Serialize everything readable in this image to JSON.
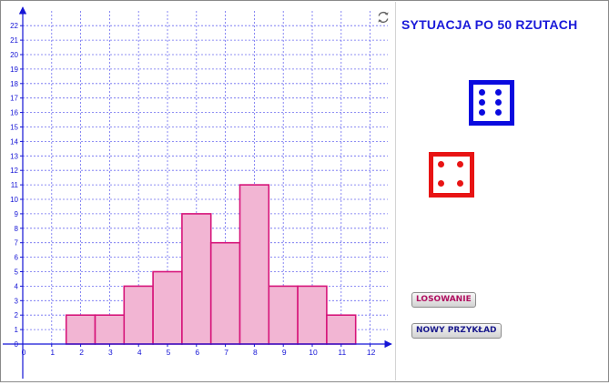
{
  "title": "SYTUACJA PO 50 RZUTACH",
  "dice": {
    "blue": {
      "value": 6,
      "color": "#0a0adf"
    },
    "red": {
      "value": 4,
      "color": "#e81414"
    }
  },
  "buttons": {
    "draw_label": "LOSOWANIE",
    "new_example_label": "NOWY PRZYKŁAD"
  },
  "icons": {
    "refresh": "refresh-icon"
  },
  "colors": {
    "axis": "#1515d6",
    "grid": "#6c6cf0",
    "bar_fill": "#f2b5d3",
    "bar_stroke": "#d6157a"
  },
  "chart_data": {
    "type": "bar",
    "title": "",
    "xlabel": "",
    "ylabel": "",
    "categories": [
      "2",
      "3",
      "4",
      "5",
      "6",
      "7",
      "8",
      "9",
      "10",
      "11"
    ],
    "values": [
      2,
      2,
      4,
      5,
      9,
      7,
      11,
      4,
      4,
      2
    ],
    "x_ticks": [
      "0",
      "1",
      "2",
      "3",
      "4",
      "5",
      "6",
      "7",
      "8",
      "9",
      "10",
      "11",
      "12"
    ],
    "y_ticks": [
      "0",
      "1",
      "2",
      "3",
      "4",
      "5",
      "6",
      "7",
      "8",
      "9",
      "10",
      "11",
      "12",
      "13",
      "14",
      "15",
      "16",
      "17",
      "18",
      "19",
      "20",
      "21",
      "22"
    ],
    "xlim": [
      0,
      12
    ],
    "ylim": [
      0,
      22
    ],
    "grid": true
  }
}
